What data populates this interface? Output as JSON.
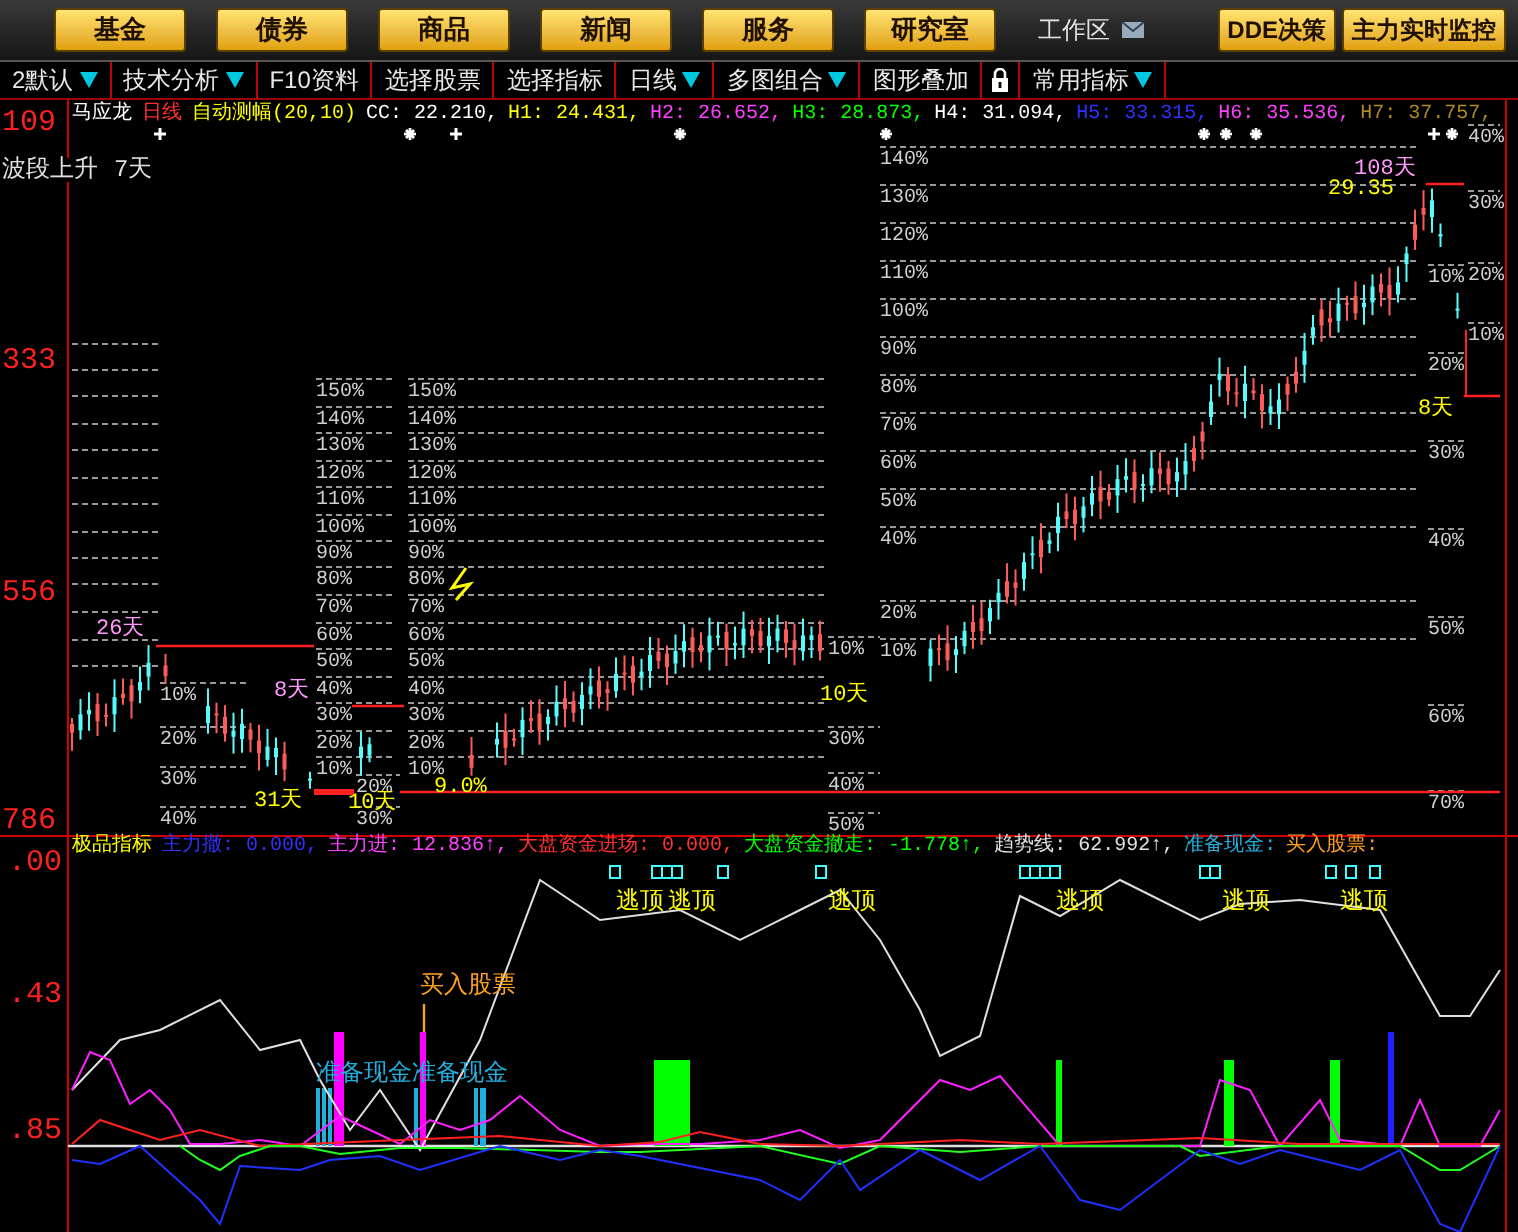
{
  "nav_buttons": [
    "基金",
    "债券",
    "商品",
    "新闻",
    "服务",
    "研究室"
  ],
  "workspace": "工作区",
  "action_buttons": [
    "DDE决策",
    "主力实时监控"
  ],
  "toolbar": [
    {
      "kind": "menu",
      "label": "2默认",
      "dropdown": true
    },
    {
      "kind": "menu",
      "label": "技术分析",
      "dropdown": true
    },
    {
      "kind": "menu",
      "label": "F10资料",
      "dropdown": false
    },
    {
      "kind": "menu",
      "label": "选择股票",
      "dropdown": false
    },
    {
      "kind": "menu",
      "label": "选择指标",
      "dropdown": false
    },
    {
      "kind": "menu",
      "label": "日线",
      "dropdown": true
    },
    {
      "kind": "menu",
      "label": "多图组合",
      "dropdown": true
    },
    {
      "kind": "menu",
      "label": "图形叠加",
      "dropdown": false
    },
    {
      "kind": "lock"
    },
    {
      "kind": "menu",
      "label": "常用指标",
      "dropdown": true
    }
  ],
  "price_axis": [
    "109",
    "333",
    "556",
    "786"
  ],
  "main_chart": {
    "header": [
      {
        "text": "马应龙",
        "color": "#ffffff"
      },
      {
        "text": "日线",
        "color": "#ff3030"
      },
      {
        "text": "自动测幅(20,10)",
        "color": "#ffff00"
      },
      {
        "text": "CC: 22.210,",
        "color": "#ffffff"
      },
      {
        "text": "H1: 24.431,",
        "color": "#ffff00"
      },
      {
        "text": "H2: 26.652,",
        "color": "#ff40ff"
      },
      {
        "text": "H3: 28.873,",
        "color": "#00ff00"
      },
      {
        "text": "H4: 31.094,",
        "color": "#ffffff"
      },
      {
        "text": "H5: 33.315,",
        "color": "#3030ff"
      },
      {
        "text": "H6: 35.536,",
        "color": "#ff40ff"
      },
      {
        "text": "H7: 37.757,",
        "color": "#b08a20"
      }
    ],
    "subtitle": [
      "波段上升",
      "7天"
    ],
    "level_groups": [
      {
        "labels": [
          "10%",
          "20%",
          "30%",
          "40%"
        ]
      },
      {
        "labels": [
          "150%",
          "140%",
          "130%",
          "120%",
          "110%",
          "100%",
          "90%",
          "80%",
          "70%",
          "60%",
          "50%",
          "40%",
          "30%",
          "20%",
          "10%"
        ]
      },
      {
        "labels": [
          "20%",
          "30%"
        ]
      },
      {
        "labels": [
          "150%",
          "140%",
          "130%",
          "120%",
          "110%",
          "100%",
          "90%",
          "80%",
          "70%",
          "60%",
          "50%",
          "40%",
          "30%",
          "20%",
          "10%"
        ]
      },
      {
        "labels": [
          "140%",
          "130%",
          "120%",
          "110%",
          "100%",
          "90%",
          "80%",
          "70%",
          "60%",
          "50%",
          "40%",
          "20%",
          "10%"
        ]
      },
      {
        "labels": [
          "10%",
          "30%",
          "40%",
          "50%"
        ]
      },
      {
        "labels": [
          "10%",
          "20%",
          "30%",
          "40%",
          "50%",
          "60%",
          "70%"
        ]
      },
      {
        "labels": [
          "40%",
          "30%",
          "20%",
          "10%"
        ]
      }
    ],
    "annotations": [
      {
        "text": "26天",
        "color": "#ff99ff"
      },
      {
        "text": "31天",
        "color": "#ffff00"
      },
      {
        "text": "10天",
        "color": "#ffff00"
      },
      {
        "text": "8天",
        "color": "#ff99ff"
      },
      {
        "text": "9.0%",
        "color": "#ffff00"
      },
      {
        "text": "10天",
        "color": "#ffff00"
      },
      {
        "text": "108天",
        "color": "#ff99ff"
      },
      {
        "text": "29.35",
        "color": "#ffff00"
      },
      {
        "text": "8天",
        "color": "#ffff00"
      }
    ]
  },
  "indicator_axis": [
    ".00",
    ".43",
    ".85"
  ],
  "indicator": {
    "title": "极品指标",
    "readouts": [
      {
        "text": "主力撤: 0.000,",
        "color": "#3030ff"
      },
      {
        "text": "主力进: 12.836↑,",
        "color": "#ff40ff"
      },
      {
        "text": "大盘资金进场: 0.000,",
        "color": "#ff3030"
      },
      {
        "text": "大盘资金撤走: -1.778↑,",
        "color": "#00ff00"
      },
      {
        "text": "趋势线: 62.992↑,",
        "color": "#e0e0e0"
      },
      {
        "text": "准备现金:",
        "color": "#20b0e0"
      },
      {
        "text": "买入股票:",
        "color": "#ffa020"
      }
    ],
    "signals": [
      {
        "kind": "top",
        "text": "逃顶"
      },
      {
        "kind": "top",
        "text": "逃顶"
      },
      {
        "kind": "top",
        "text": "逃顶"
      },
      {
        "kind": "top",
        "text": "逃顶"
      },
      {
        "kind": "top",
        "text": "逃顶"
      },
      {
        "kind": "top",
        "text": "逃顶"
      },
      {
        "kind": "buy",
        "text": "买入股票"
      },
      {
        "kind": "cash",
        "text": "准备现金"
      },
      {
        "kind": "cash",
        "text": "准备现金"
      }
    ]
  }
}
